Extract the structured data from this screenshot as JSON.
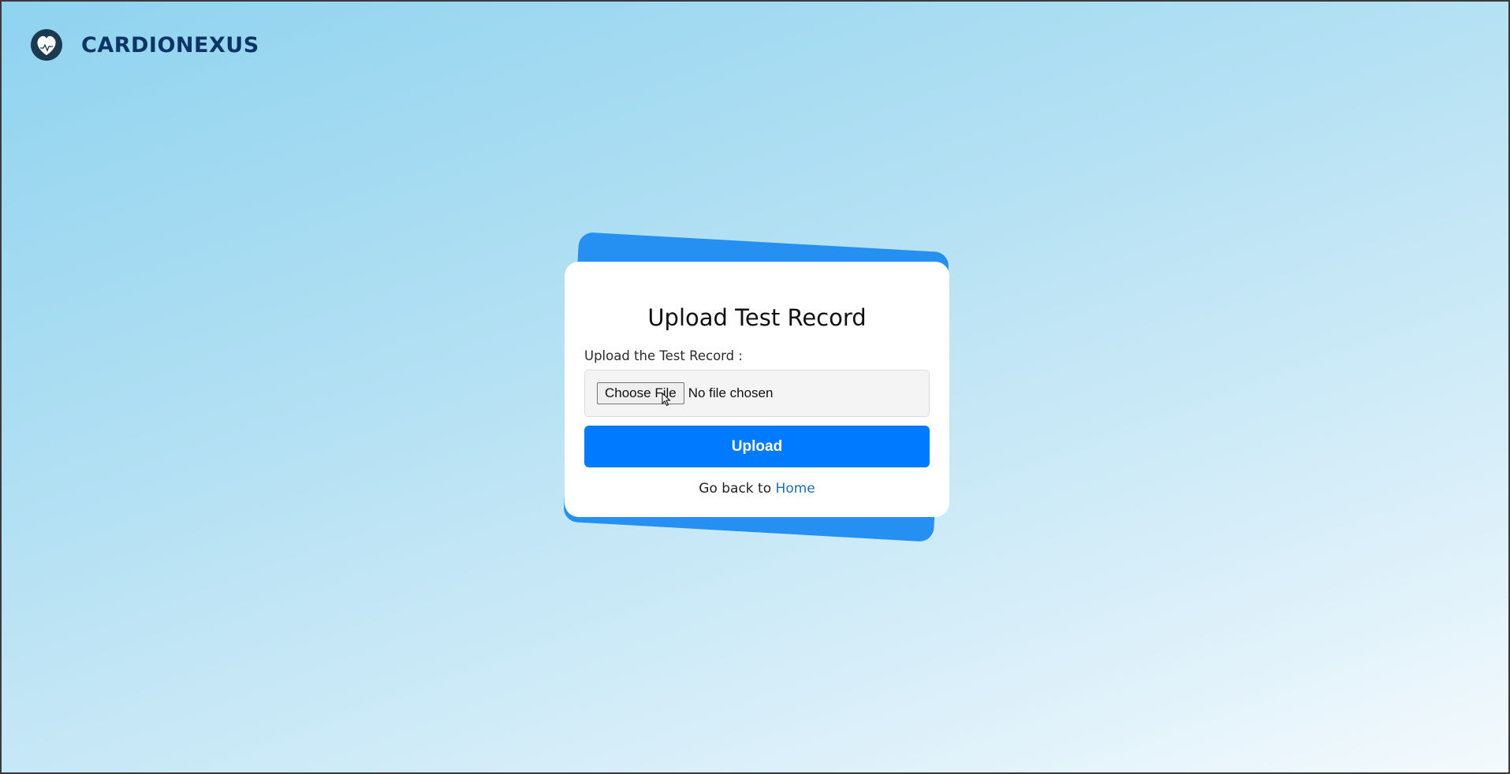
{
  "brand": {
    "name": "CARDIONEXUS",
    "logo_icon": "heart-logo-icon"
  },
  "card": {
    "title": "Upload Test Record",
    "field_label": "Upload the Test Record :",
    "file_input": {
      "button_label": "Choose File",
      "status_text": "No file chosen"
    },
    "upload_button_label": "Upload",
    "back_prefix": "Go back to",
    "back_link_label": "Home"
  },
  "colors": {
    "accent": "#007bff",
    "card_back": "#2590f2",
    "brand_text": "#0c3565",
    "link": "#1f6fb0"
  }
}
